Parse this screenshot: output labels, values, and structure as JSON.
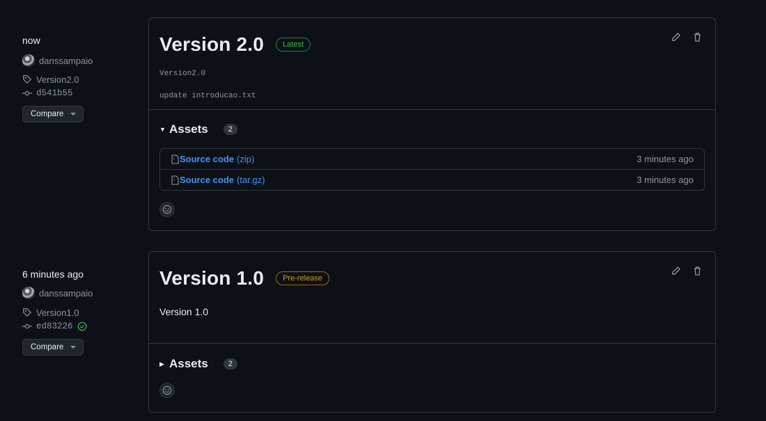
{
  "releases": [
    {
      "time": "now",
      "author": "danssampaio",
      "tag": "Version2.0",
      "commit": "d541b55",
      "compare_label": "Compare",
      "title": "Version 2.0",
      "badge": "Latest",
      "body_lines": [
        "Version2.0",
        "update introducao.txt"
      ],
      "assets_label": "Assets",
      "assets_count": "2",
      "assets": [
        {
          "name": "Source code",
          "ext": "(zip)",
          "age": "3 minutes ago"
        },
        {
          "name": "Source code",
          "ext": "(tar.gz)",
          "age": "3 minutes ago"
        }
      ]
    },
    {
      "time": "6 minutes ago",
      "author": "danssampaio",
      "tag": "Version1.0",
      "commit": "ed83226",
      "compare_label": "Compare",
      "title": "Version 1.0",
      "badge": "Pre-release",
      "body": "Version 1.0",
      "assets_label": "Assets",
      "assets_count": "2"
    }
  ],
  "icons": {
    "tag": "tag-icon",
    "commit": "commit-icon",
    "edit": "pencil-icon",
    "delete": "trash-icon",
    "file": "file-zip-icon",
    "react": "smiley-icon",
    "verified": "check-circle-icon"
  },
  "colors": {
    "background": "#0d1117",
    "link": "#4493f8",
    "latest": "#3fb950",
    "prerelease": "#d29922"
  }
}
